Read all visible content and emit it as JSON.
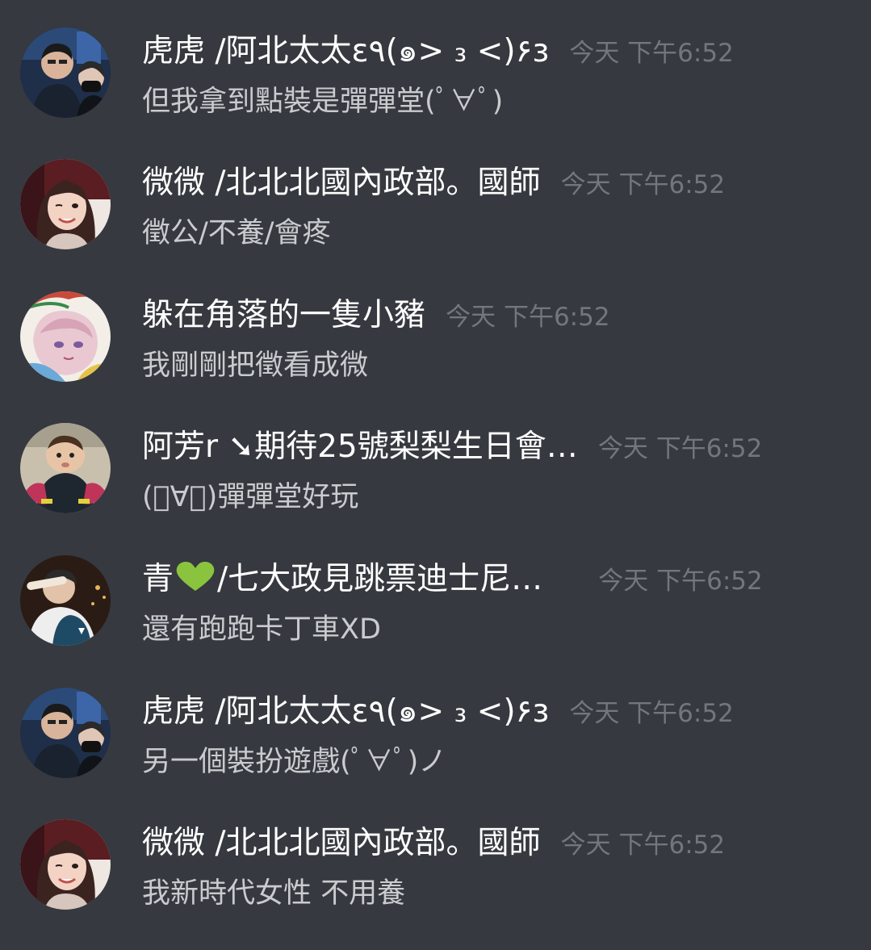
{
  "messages": [
    {
      "username": "虎虎 /阿北太太ε٩(๑> ₃ <)۶з",
      "timestamp": "今天 下午6:52",
      "content": "但我拿到點裝是彈彈堂(ﾟ∀ﾟ)",
      "avatar_icon": "couple-selfie-avatar"
    },
    {
      "username": "微微 /北北北國內政部。國師",
      "timestamp": "今天 下午6:52",
      "content": "徵公/不養/會疼",
      "avatar_icon": "woman-winking-avatar"
    },
    {
      "username": "躲在角落的一隻小豬",
      "timestamp": "今天 下午6:52",
      "content": "我剛剛把徵看成微",
      "avatar_icon": "anime-character-avatar"
    },
    {
      "username": "阿芳r ➘期待25號梨梨生日會…",
      "timestamp": "今天 下午6:52",
      "content": "(ﾟ∀ﾟ)彈彈堂好玩",
      "avatar_icon": "baby-avatar"
    },
    {
      "username_prefix": "青",
      "username_suffix": "/七大政見跳票迪士尼…",
      "timestamp": "今天 下午6:52",
      "content": "還有跑跑卡丁車XD",
      "avatar_icon": "boy-jacket-avatar",
      "heart_color": "#8ac43f"
    },
    {
      "username": "虎虎 /阿北太太ε٩(๑> ₃ <)۶з",
      "timestamp": "今天 下午6:52",
      "content": "另一個裝扮遊戲(ﾟ∀ﾟ)ノ",
      "avatar_icon": "couple-selfie-avatar"
    },
    {
      "username": "微微 /北北北國內政部。國師",
      "timestamp": "今天 下午6:52",
      "content": "我新時代女性 不用養",
      "avatar_icon": "woman-winking-avatar"
    }
  ],
  "colors": {
    "background": "#36393f",
    "username": "#ffffff",
    "timestamp": "#72767d",
    "content": "#c9cbcf"
  }
}
